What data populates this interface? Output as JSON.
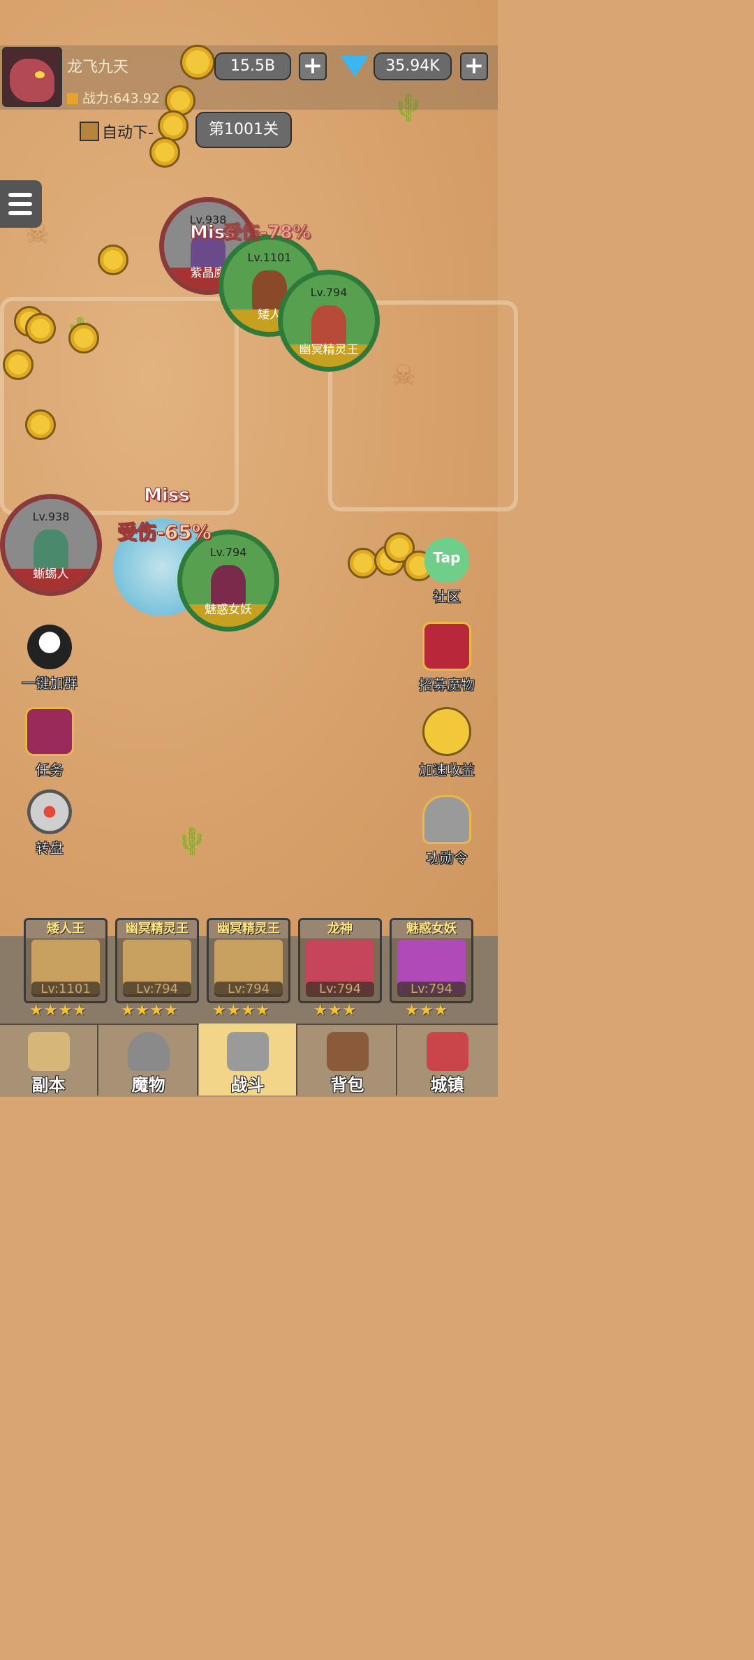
{
  "player": {
    "name": "龙飞九天",
    "power": "战力:643.92"
  },
  "currency": {
    "gold": "15.5B",
    "gems": "35.94K",
    "plus": "+"
  },
  "auto_label": "自动下-",
  "stage_label": "第1001关",
  "units": [
    {
      "level": "Lv.938",
      "name": "紫晶魔",
      "side": "enemy"
    },
    {
      "level": "Lv.1101",
      "name": "矮人",
      "side": "ally"
    },
    {
      "level": "Lv.794",
      "name": "幽冥精灵王",
      "side": "ally"
    },
    {
      "level": "Lv.938",
      "name": "蜥蜴人",
      "side": "enemy"
    },
    {
      "level": "Lv.794",
      "name": "魅惑女妖",
      "side": "ally"
    }
  ],
  "float_texts": {
    "miss1": "Miss",
    "dmg1": "受伤-78%",
    "miss2": "Miss",
    "dmg2": "受伤-65%"
  },
  "side_icons": {
    "left": [
      {
        "label": "一键加群",
        "icon": "penguin-icon"
      },
      {
        "label": "任务",
        "icon": "book-icon"
      },
      {
        "label": "转盘",
        "icon": "wheel-icon"
      }
    ],
    "right": [
      {
        "label": "社区",
        "icon": "tap-bubble-icon",
        "tag": "Tap"
      },
      {
        "label": "招募魔物",
        "icon": "banner-icon"
      },
      {
        "label": "加速收益",
        "icon": "coin-up-icon"
      },
      {
        "label": "功勋令",
        "icon": "helmet-icon"
      }
    ]
  },
  "roster": [
    {
      "name": "矮人王",
      "level": "Lv:1101",
      "stars": "★★★★"
    },
    {
      "name": "幽冥精灵王",
      "level": "Lv:794",
      "stars": "★★★★"
    },
    {
      "name": "幽冥精灵王",
      "level": "Lv:794",
      "stars": "★★★★"
    },
    {
      "name": "龙神",
      "level": "Lv:794",
      "stars": "★★★"
    },
    {
      "name": "魅惑女妖",
      "level": "Lv:794",
      "stars": "★★★"
    }
  ],
  "nav": [
    {
      "label": "副本",
      "icon": "map-icon"
    },
    {
      "label": "魔物",
      "icon": "monster-helmet-icon"
    },
    {
      "label": "战斗",
      "icon": "crossed-swords-icon",
      "active": true
    },
    {
      "label": "背包",
      "icon": "backpack-icon"
    },
    {
      "label": "城镇",
      "icon": "town-icon"
    }
  ],
  "colors": {
    "enemy_ring": "#8a3a3a",
    "ally_ring": "#2e7a3a",
    "gold": "#f2c73a",
    "gem": "#3cb6f0"
  }
}
